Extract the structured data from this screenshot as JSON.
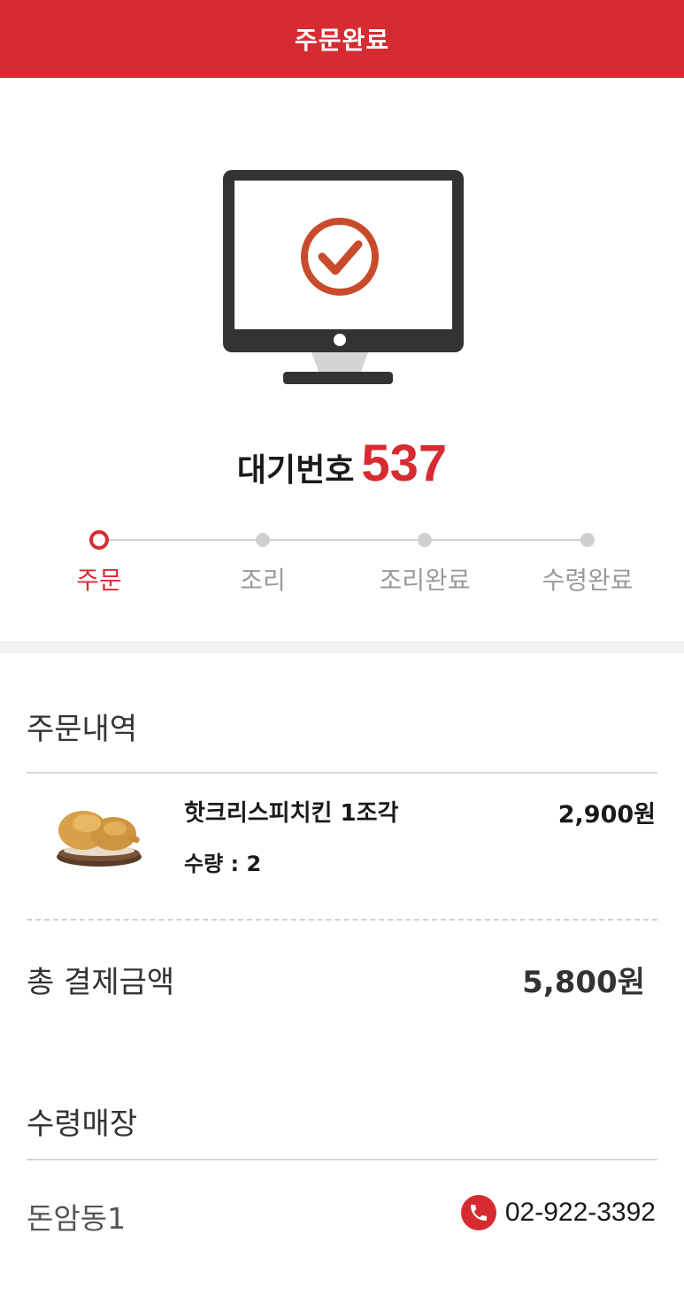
{
  "header": {
    "title": "주문완료"
  },
  "waiting": {
    "label": "대기번호",
    "number": "537"
  },
  "steps": [
    {
      "label": "주문",
      "active": true
    },
    {
      "label": "조리",
      "active": false
    },
    {
      "label": "조리완료",
      "active": false
    },
    {
      "label": "수령완료",
      "active": false
    }
  ],
  "order": {
    "title": "주문내역",
    "items": [
      {
        "name": "핫크리스피치킨 1조각",
        "qty_label": "수량 : ",
        "qty": "2",
        "price": "2,900원",
        "icon": "fried-chicken-image"
      }
    ],
    "total_label": "총 결제금액",
    "total_value": "5,800원"
  },
  "store": {
    "title": "수령매장",
    "name": "돈암동1",
    "phone": "02-922-3392",
    "phone_icon": "phone-icon"
  },
  "colors": {
    "brand": "#d72b32",
    "inactive": "#cfcfcf"
  }
}
